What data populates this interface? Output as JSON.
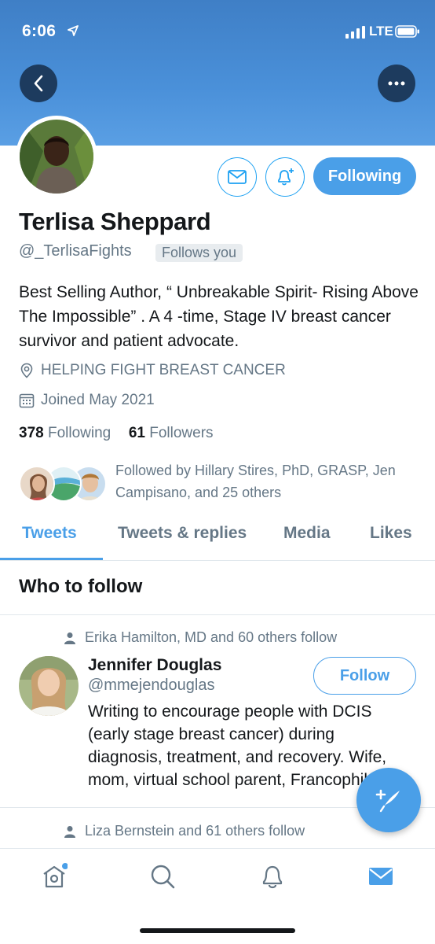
{
  "status_bar": {
    "time": "6:06",
    "network": "LTE"
  },
  "profile": {
    "name": "Terlisa Sheppard",
    "handle": "@_TerlisaFights",
    "follows_you_badge": "Follows you",
    "following_button": "Following",
    "bio": "Best Selling Author, “ Unbreakable Spirit- Rising Above The Impossible” . A 4 -time, Stage IV breast cancer survivor and patient advocate.",
    "location": "HELPING FIGHT BREAST CANCER",
    "joined": "Joined May 2021",
    "following_count": "378",
    "following_label": "Following",
    "followers_count": "61",
    "followers_label": "Followers",
    "followed_by": "Followed by Hillary Stires, PhD, GRASP, Jen Campisano, and 25 others"
  },
  "tabs": [
    {
      "label": "Tweets",
      "active": true
    },
    {
      "label": "Tweets & replies",
      "active": false
    },
    {
      "label": "Media",
      "active": false
    },
    {
      "label": "Likes",
      "active": false
    }
  ],
  "who_to_follow": {
    "title": "Who to follow",
    "suggestions": [
      {
        "context": "Erika Hamilton, MD and 60 others follow",
        "name": "Jennifer Douglas",
        "handle": "@mmejendouglas",
        "button": "Follow",
        "bio": "Writing to encourage people with DCIS (early stage breast cancer) during diagnosis, treatment, and recovery. Wife, mom, virtual school parent, Francophile"
      },
      {
        "context": "Liza Bernstein and 61 others follow"
      }
    ]
  },
  "bottom_nav": [
    "home-icon",
    "search-icon",
    "notifications-icon",
    "messages-icon"
  ],
  "colors": {
    "accent": "#4a9fe8",
    "banner": "#4a90d9",
    "muted": "#657786",
    "text": "#14171a"
  }
}
